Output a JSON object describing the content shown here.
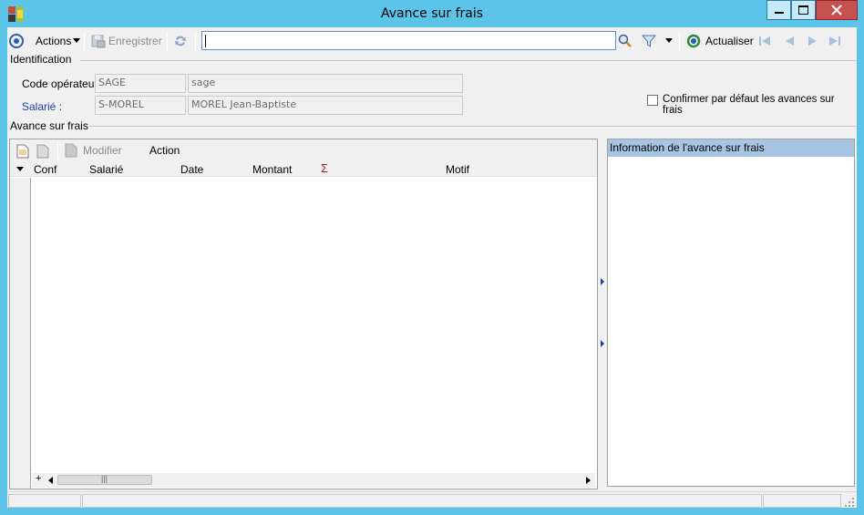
{
  "window": {
    "title": "Avance sur frais",
    "icon": "app-icon"
  },
  "toolbar": {
    "actions_label": "Actions",
    "save_label": "Enregistrer",
    "search_value": "",
    "refresh_label": "Actualiser"
  },
  "identification": {
    "section_label": "Identification",
    "operator_label": "Code opérateur :",
    "operator_code": "SAGE",
    "operator_name": "sage",
    "employee_label": "Salarié :",
    "employee_code": "S-MOREL",
    "employee_name": "MOREL Jean-Baptiste",
    "confirm_label": "Confirmer par défaut les avances sur frais",
    "confirm_checked": false
  },
  "advances": {
    "section_label": "Avance sur frais",
    "modify_label": "Modifier",
    "action_label": "Action",
    "columns": [
      "Conf",
      "Salarié",
      "Date",
      "Montant",
      "Σ",
      "Motif"
    ],
    "rows": []
  },
  "info_panel": {
    "title": "Information de l'avance sur frais"
  },
  "colors": {
    "title_bar": "#5bc4e8",
    "close_button": "#c75050",
    "info_header": "#a7c5e3",
    "label_blue": "#1f3fa8",
    "sigma_red": "#b22222"
  }
}
